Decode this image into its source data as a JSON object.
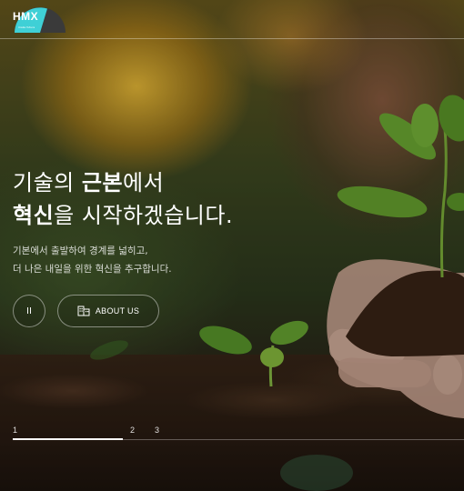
{
  "brand": {
    "logo_text": "HMX",
    "logo_sub": "make future",
    "accent": "#3fd0d6"
  },
  "hero": {
    "title_line1_pre": "기술의 ",
    "title_line1_bold": "근본",
    "title_line1_post": "에서",
    "title_line2_bold": "혁신",
    "title_line2_post": "을 시작하겠습니다.",
    "subtitle_line1": "기본에서 출발하여 경계를 넓히고,",
    "subtitle_line2": "더 나은 내일을 위한 혁신을 추구합니다."
  },
  "controls": {
    "pause_glyph": "II",
    "about_label": "ABOUT US",
    "about_icon": "building-icon"
  },
  "pager": {
    "slides": [
      "1",
      "2",
      "3"
    ],
    "current": 1,
    "progress_fraction": 0.25
  }
}
